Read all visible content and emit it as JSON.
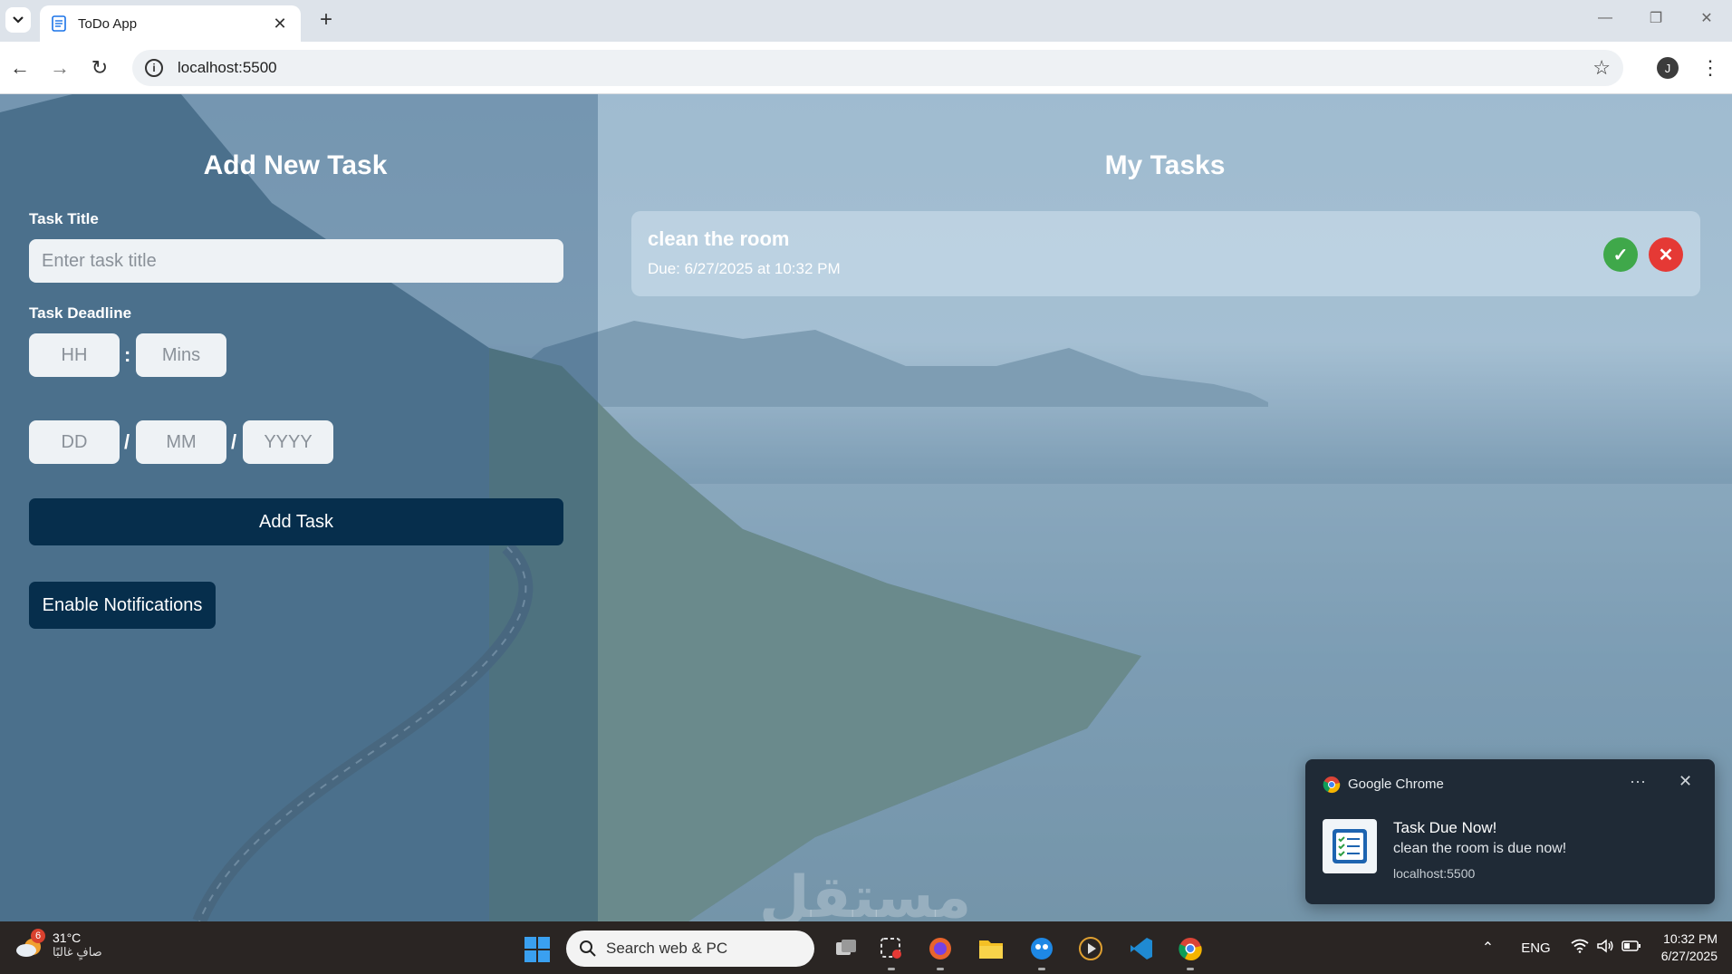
{
  "browser": {
    "tab_title": "ToDo App",
    "url": "localhost:5500",
    "profile_initial": "J"
  },
  "form": {
    "heading": "Add New Task",
    "title_label": "Task Title",
    "title_placeholder": "Enter task title",
    "deadline_label": "Task Deadline",
    "hour_placeholder": "HH",
    "minute_placeholder": "Mins",
    "time_separator": ":",
    "day_placeholder": "DD",
    "month_placeholder": "MM",
    "year_placeholder": "YYYY",
    "date_separator": "/",
    "add_button": "Add Task",
    "notify_button": "Enable Notifications"
  },
  "tasks": {
    "heading": "My Tasks",
    "items": [
      {
        "title": "clean the room",
        "due": "Due: 6/27/2025 at 10:32 PM"
      }
    ]
  },
  "watermark": "مستقل",
  "notification": {
    "app": "Google Chrome",
    "title": "Task Due Now!",
    "body": "clean the room is due now!",
    "origin": "localhost:5500"
  },
  "taskbar": {
    "weather_temp": "31°C",
    "weather_desc": "صافٍ غالبًا",
    "weather_badge": "6",
    "search_label": "Search web & PC",
    "language": "ENG",
    "time": "10:32 PM",
    "date": "6/27/2025"
  },
  "colors": {
    "primary_button": "#062e4c",
    "done_button": "#3fa84a",
    "delete_button": "#e53935"
  }
}
